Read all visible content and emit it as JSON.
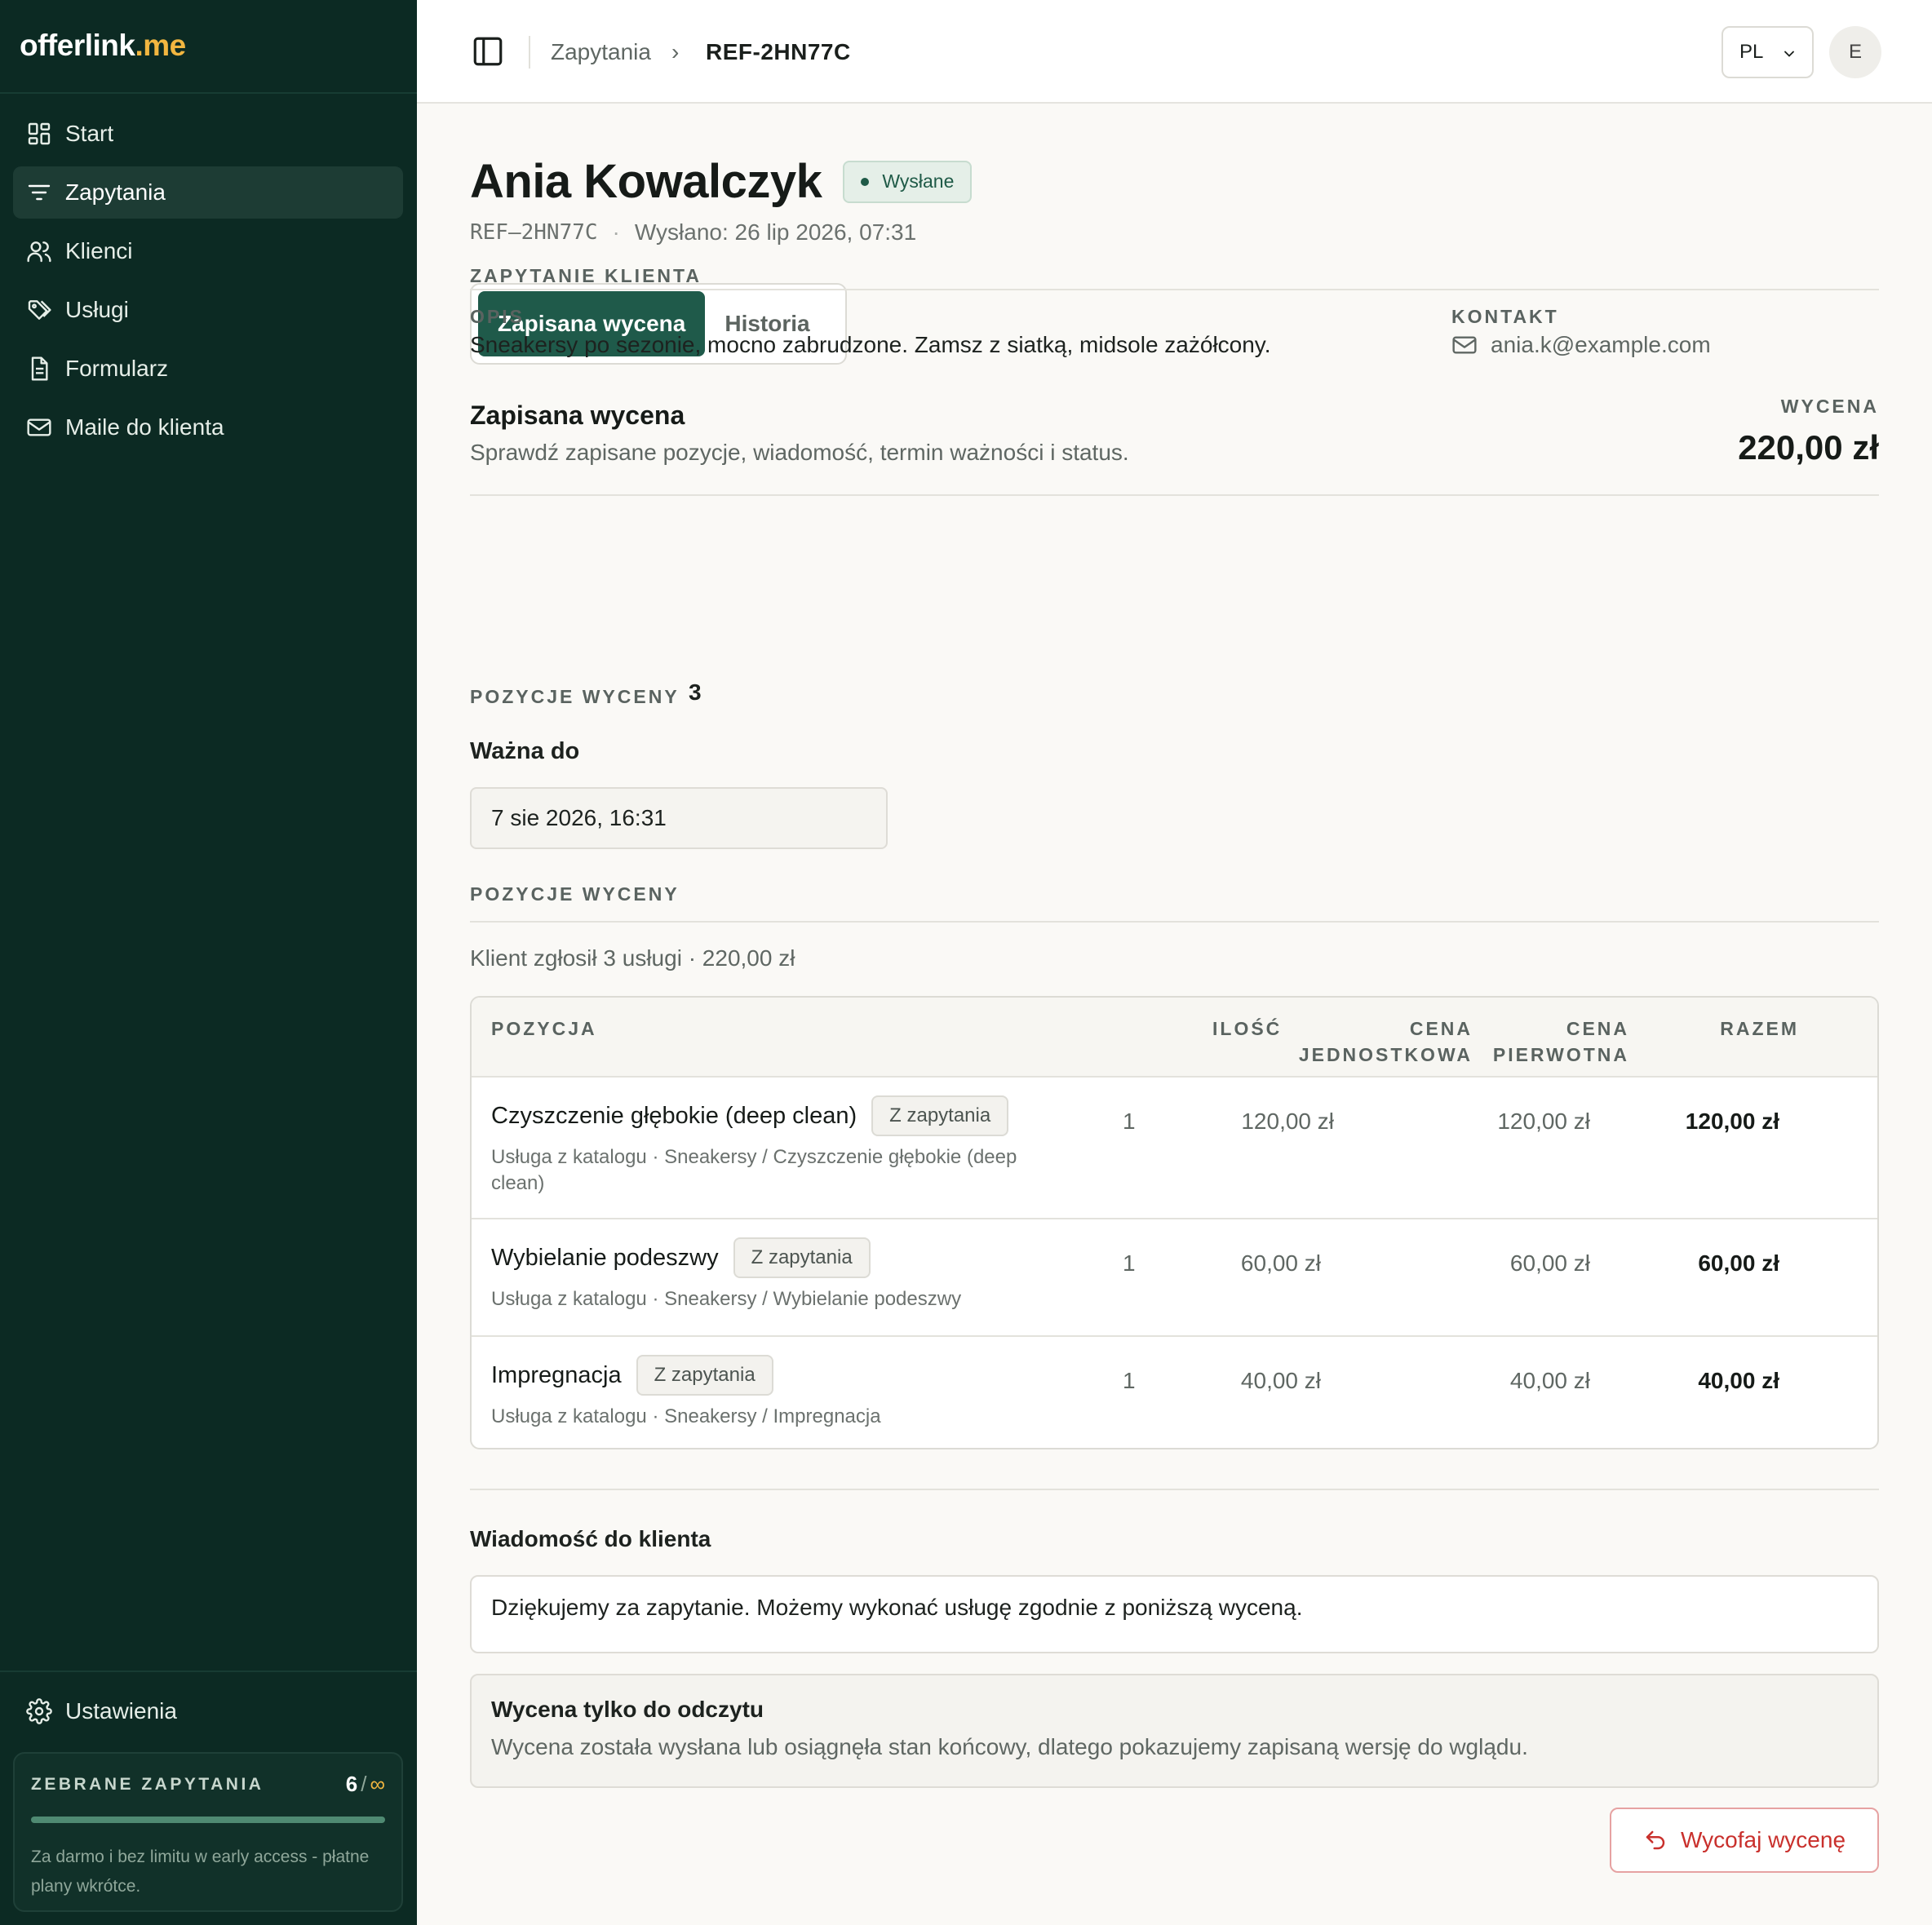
{
  "app": {
    "logo_main": "offerlink",
    "logo_accent": ".me"
  },
  "sidebar": {
    "items": [
      {
        "label": "Start",
        "icon": "dashboard-icon"
      },
      {
        "label": "Zapytania",
        "icon": "filter-lines-icon",
        "active": true
      },
      {
        "label": "Klienci",
        "icon": "users-icon"
      },
      {
        "label": "Usługi",
        "icon": "tags-icon"
      },
      {
        "label": "Formularz",
        "icon": "document-icon"
      },
      {
        "label": "Maile do klienta",
        "icon": "mail-icon"
      }
    ],
    "settings_label": "Ustawienia",
    "quota": {
      "title": "ZEBRANE ZAPYTANIA",
      "count": "6",
      "separator": "/",
      "limit": "∞",
      "progress": 1.0,
      "note": "Za darmo i bez limitu w early access - płatne plany wkrótce."
    }
  },
  "topbar": {
    "breadcrumb": [
      "Zapytania",
      "REF-2HN77C"
    ],
    "language": "PL",
    "avatar_initial": "E"
  },
  "header": {
    "title": "Ania Kowalczyk",
    "status": "Wysłane",
    "ref": "REF–2HN77C",
    "sent": "Wysłano: 26 lip 2026, 07:31"
  },
  "tabs": [
    "Zapisana wycena",
    "Historia"
  ],
  "request": {
    "section_title": "ZAPYTANIE KLIENTA",
    "description_label": "OPIS",
    "description": "Sneakersy po sezonie, mocno zabrudzone. Zamsz z siatką, midsole zażółcony.",
    "contact_label": "KONTAKT",
    "contact_email": "ania.k@example.com"
  },
  "quote": {
    "title": "Zapisana wycena",
    "subtitle": "Sprawdź zapisane pozycje, wiadomość, termin ważności i status.",
    "total_label": "WYCENA",
    "total": "220,00 zł",
    "items_label": "POZYCJE WYCENY",
    "items_count": "3",
    "valid_until_label": "Ważna do",
    "valid_until": "7 sie 2026, 16:31",
    "items_section_title": "POZYCJE WYCENY",
    "client_summary": "Klient zgłosił 3 usługi · 220,00 zł"
  },
  "table": {
    "headers": {
      "position": "POZYCJA",
      "quantity": "ILOŚĆ",
      "unit_price_1": "CENA",
      "unit_price_2": "JEDNOSTKOWA",
      "original_price_1": "CENA",
      "original_price_2": "PIERWOTNA",
      "total": "RAZEM"
    },
    "rows": [
      {
        "name": "Czyszczenie głębokie (deep clean)",
        "tag": "Z zapytania",
        "sub": "Usługa z katalogu · Sneakersy / Czyszczenie głębokie (deep clean)",
        "qty": "1",
        "unit": "120,00 zł",
        "original": "120,00 zł",
        "total": "120,00 zł"
      },
      {
        "name": "Wybielanie podeszwy",
        "tag": "Z zapytania",
        "sub": "Usługa z katalogu · Sneakersy / Wybielanie podeszwy",
        "qty": "1",
        "unit": "60,00 zł",
        "original": "60,00 zł",
        "total": "60,00 zł"
      },
      {
        "name": "Impregnacja",
        "tag": "Z zapytania",
        "sub": "Usługa z katalogu · Sneakersy / Impregnacja",
        "qty": "1",
        "unit": "40,00 zł",
        "original": "40,00 zł",
        "total": "40,00 zł"
      }
    ]
  },
  "message": {
    "label": "Wiadomość do klienta",
    "text": "Dziękujemy za zapytanie. Możemy wykonać usługę zgodnie z poniższą wyceną."
  },
  "readonly_notice": {
    "title": "Wycena tylko do odczytu",
    "text": "Wycena została wysłana lub osiągnęła stan końcowy, dlatego pokazujemy zapisaną wersję do wglądu."
  },
  "actions": {
    "withdraw_label": "Wycofaj wycenę"
  },
  "colors": {
    "sidebar_bg": "#0c2a23",
    "accent": "#1f5a4a",
    "logo_accent": "#f2b640",
    "danger": "#c9302c"
  }
}
